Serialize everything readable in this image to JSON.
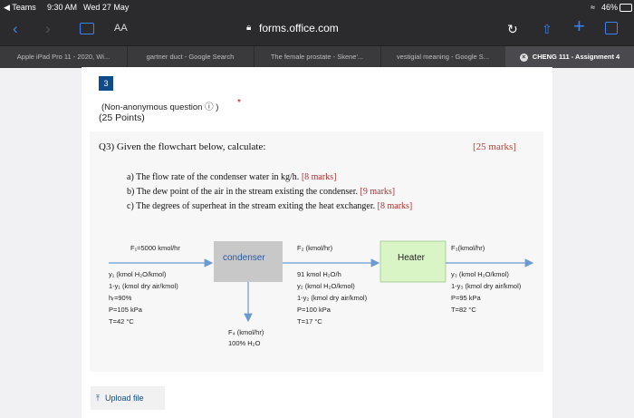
{
  "status_bar": {
    "back_app": "◀ Teams",
    "time": "9:30 AM",
    "date": "Wed 27 May",
    "battery": "46%"
  },
  "browser": {
    "aa": "AA",
    "url": "forms.office.com"
  },
  "tabs": [
    {
      "label": "Apple iPad Pro 11 - 2020, Wi..."
    },
    {
      "label": "gartner duct - Google Search"
    },
    {
      "label": "The female prostate - Skene'..."
    },
    {
      "label": "vestigial meaning - Google S..."
    },
    {
      "label": "CHENG 111 - Assignment 4"
    }
  ],
  "question": {
    "number": "3",
    "meta": "(Non-anonymous question ⓘ )",
    "required": "*",
    "points": "(25 Points)",
    "prompt": "Q3) Given the flowchart below, calculate:",
    "marks": "[25 marks]",
    "items": [
      {
        "text": "a)  The flow rate of the condenser water in kg/h.",
        "marks": "[8 marks]"
      },
      {
        "text": "b)  The dew point of the air in the stream existing the condenser.",
        "marks": "[9 marks]"
      },
      {
        "text": "c)  The degrees of superheat in the stream exiting the heat exchanger.",
        "marks": "[8 marks]"
      }
    ]
  },
  "flowchart": {
    "f1_label": "F₁=5000 kmol/hr",
    "stream1": [
      "y₁ (kmol H₂O/kmol)",
      "1-y₁ (kmol dry air/kmol)",
      "hᵣ=90%",
      "P=105 kPa",
      "T=42 °C"
    ],
    "condenser": "condenser",
    "f2_label": "F₂ (kmol/hr)",
    "stream2": [
      "91 kmol H₂O/h",
      "y₂ (kmol H₂O/kmol)",
      "1-y₂ (kmol dry air/kmol)",
      "P=100 kPa",
      "T=17 °C"
    ],
    "f4_label": "F₄ (kmol/hr)",
    "f4_comp": "100% H₂O",
    "heater": "Heater",
    "f3_label": "F₃(kmol/hr)",
    "stream3": [
      "y₃ (kmol H₂O/kmol)",
      "1-y₃ (kmol dry air/kmol)",
      "P=95 kPa",
      "T=82 °C"
    ]
  },
  "upload": {
    "label": "Upload file"
  }
}
